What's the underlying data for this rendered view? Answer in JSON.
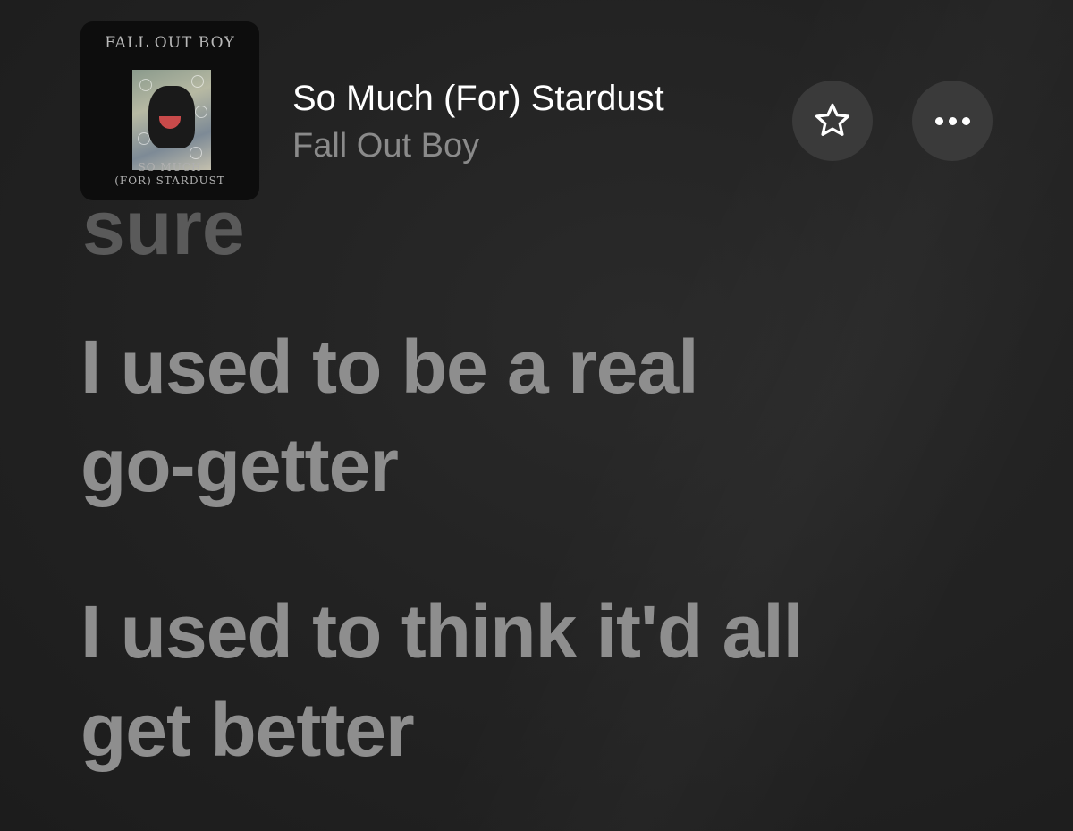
{
  "now_playing": {
    "artwork": {
      "band_text": "FALL OUT BOY",
      "album_line1": "SO MUCH",
      "album_line2": "(FOR) STARDUST"
    },
    "title": "So Much (For) Stardust",
    "artist": "Fall Out Boy"
  },
  "actions": {
    "favorite_icon": "star-icon",
    "more_icon": "ellipsis-icon"
  },
  "lyrics": {
    "previous_fragment": "sure",
    "lines": [
      {
        "row1": "I used to be a real",
        "row2": "go-getter"
      },
      {
        "row1": "I used to think it'd all",
        "row2": "get better"
      }
    ]
  },
  "colors": {
    "background": "#232323",
    "title": "#ffffff",
    "artist": "#8a8a8a",
    "lyric": "#8e8e8e",
    "button_bg": "#3a3a3a"
  }
}
